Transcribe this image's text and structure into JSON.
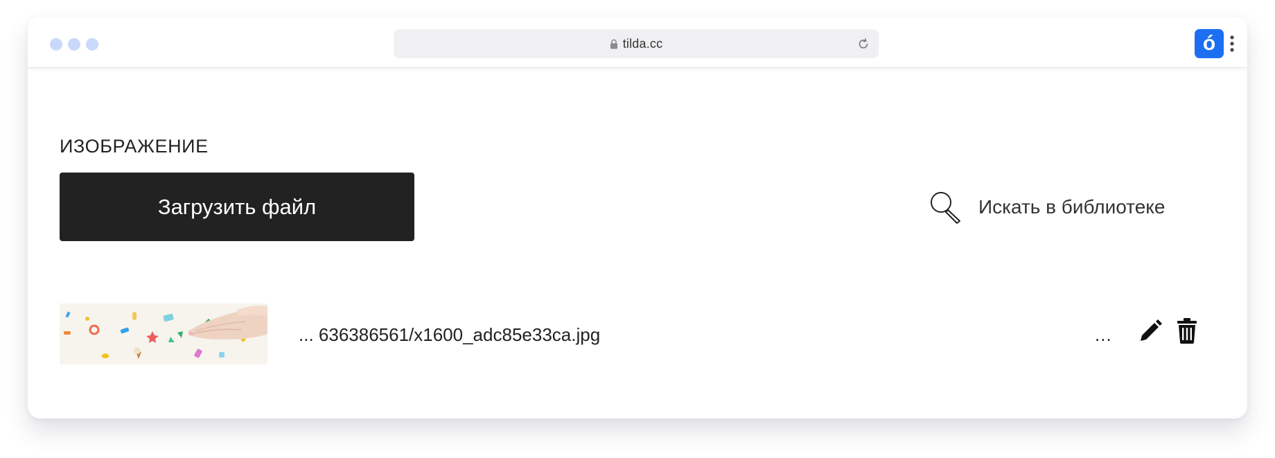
{
  "browser": {
    "url": "tilda.cc",
    "extension_letter": "ó",
    "colors": {
      "traffic_dots": "#c9d9fb",
      "extension_bg": "#1d6ff2",
      "url_bar_bg": "#f0f0f2"
    }
  },
  "section": {
    "title": "ИЗОБРАЖЕНИЕ"
  },
  "actions": {
    "upload_label": "Загрузить файл",
    "search_library_label": "Искать в библиотеке"
  },
  "file": {
    "name": "... 636386561/x1600_adc85e33ca.jpg",
    "more_label": "..."
  },
  "icons": [
    "lock-icon",
    "reload-icon",
    "kebab-icon",
    "magnifier-icon",
    "edit-icon",
    "trash-icon"
  ],
  "colors": {
    "button_bg": "#222222",
    "button_text": "#ffffff",
    "text": "#222222"
  }
}
